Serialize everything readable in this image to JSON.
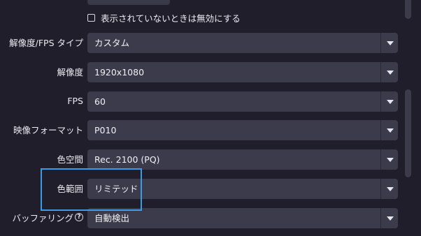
{
  "checkbox": {
    "label": "表示されていないときは無効にする",
    "checked": false
  },
  "settings": [
    {
      "label": "解像度/FPS タイプ",
      "value": "カスタム"
    },
    {
      "label": "解像度",
      "value": "1920x1080"
    },
    {
      "label": "FPS",
      "value": "60"
    },
    {
      "label": "映像フォーマット",
      "value": "P010"
    },
    {
      "label": "色空間",
      "value": "Rec. 2100 (PQ)"
    },
    {
      "label": "色範囲",
      "value": "リミテッド"
    },
    {
      "label": "バッファリング",
      "value": "自動検出"
    }
  ],
  "highlight_color": "#3a9be6"
}
